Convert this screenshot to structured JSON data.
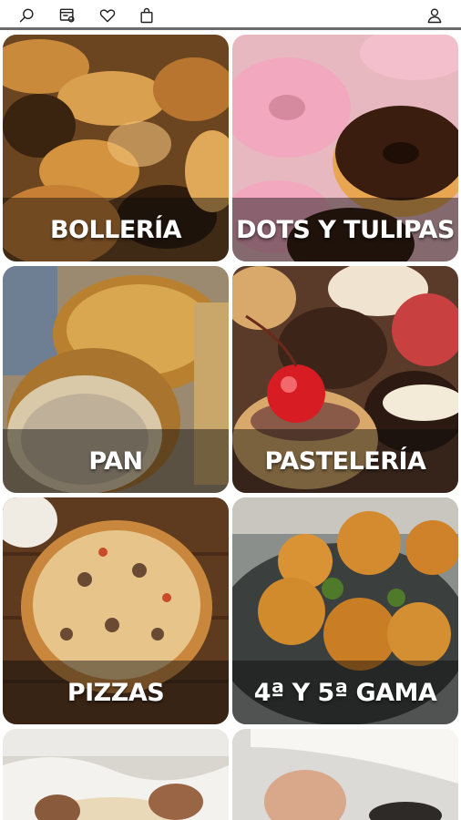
{
  "header": {
    "icons": [
      "search-icon",
      "store-catalog-icon",
      "heart-icon",
      "shopping-bag-icon",
      "user-icon"
    ]
  },
  "categories": [
    {
      "label": "BOLLERÍA",
      "theme": "croissants"
    },
    {
      "label": "DOTS Y TULIPAS",
      "theme": "donuts"
    },
    {
      "label": "PAN",
      "theme": "bread"
    },
    {
      "label": "PASTELERÍA",
      "theme": "tarts"
    },
    {
      "label": "PIZZAS",
      "theme": "pizza"
    },
    {
      "label": "4ª Y 5ª GAMA",
      "theme": "croquettes"
    },
    {
      "label": "",
      "theme": "chef-dough"
    },
    {
      "label": "",
      "theme": "chef-plating"
    }
  ],
  "colors": {
    "header_border": "#6b6b6b",
    "label_text": "#ffffff",
    "label_band": "rgba(10,10,10,0.45)"
  }
}
